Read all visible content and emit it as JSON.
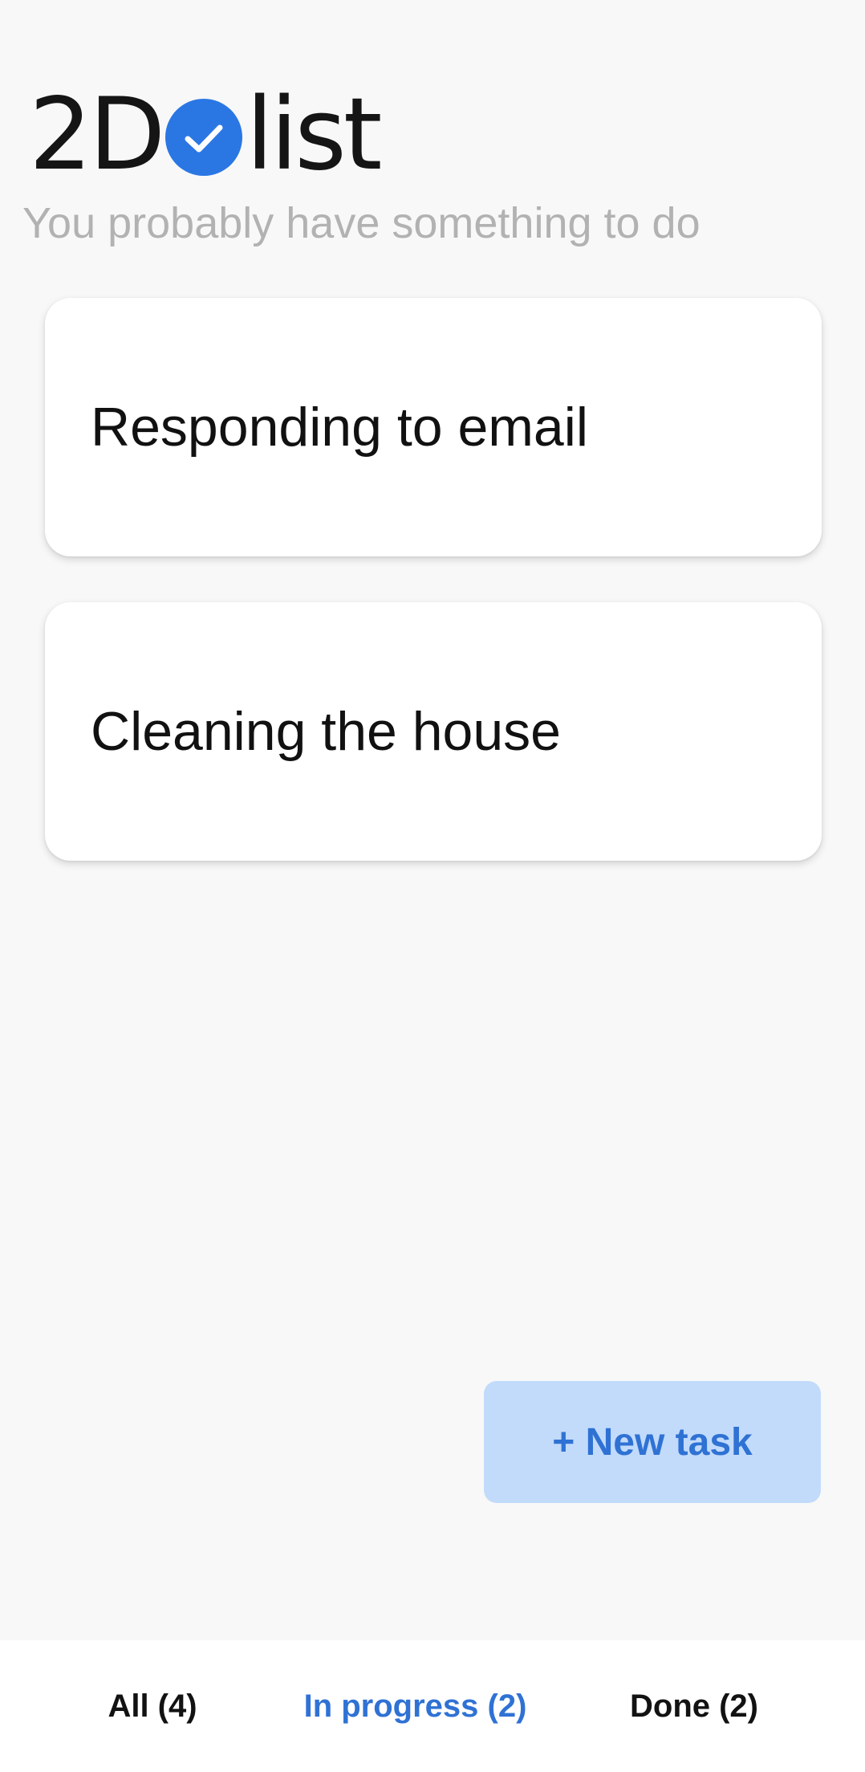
{
  "app": {
    "logo_left": "2D",
    "logo_right": "list",
    "logo_accent_color": "#2a77e4",
    "subtitle": "You probably have something to do"
  },
  "tasks": [
    {
      "title": "Responding to email"
    },
    {
      "title": "Cleaning the house"
    }
  ],
  "actions": {
    "new_task_label": "+ New task"
  },
  "tabs": [
    {
      "label": "All (4)",
      "active": false
    },
    {
      "label": "In progress (2)",
      "active": true
    },
    {
      "label": "Done (2)",
      "active": false
    }
  ],
  "colors": {
    "background": "#f8f8f8",
    "accent": "#2f72d4",
    "button_background": "#c2dbfb",
    "muted_text": "#b2b2b2"
  }
}
